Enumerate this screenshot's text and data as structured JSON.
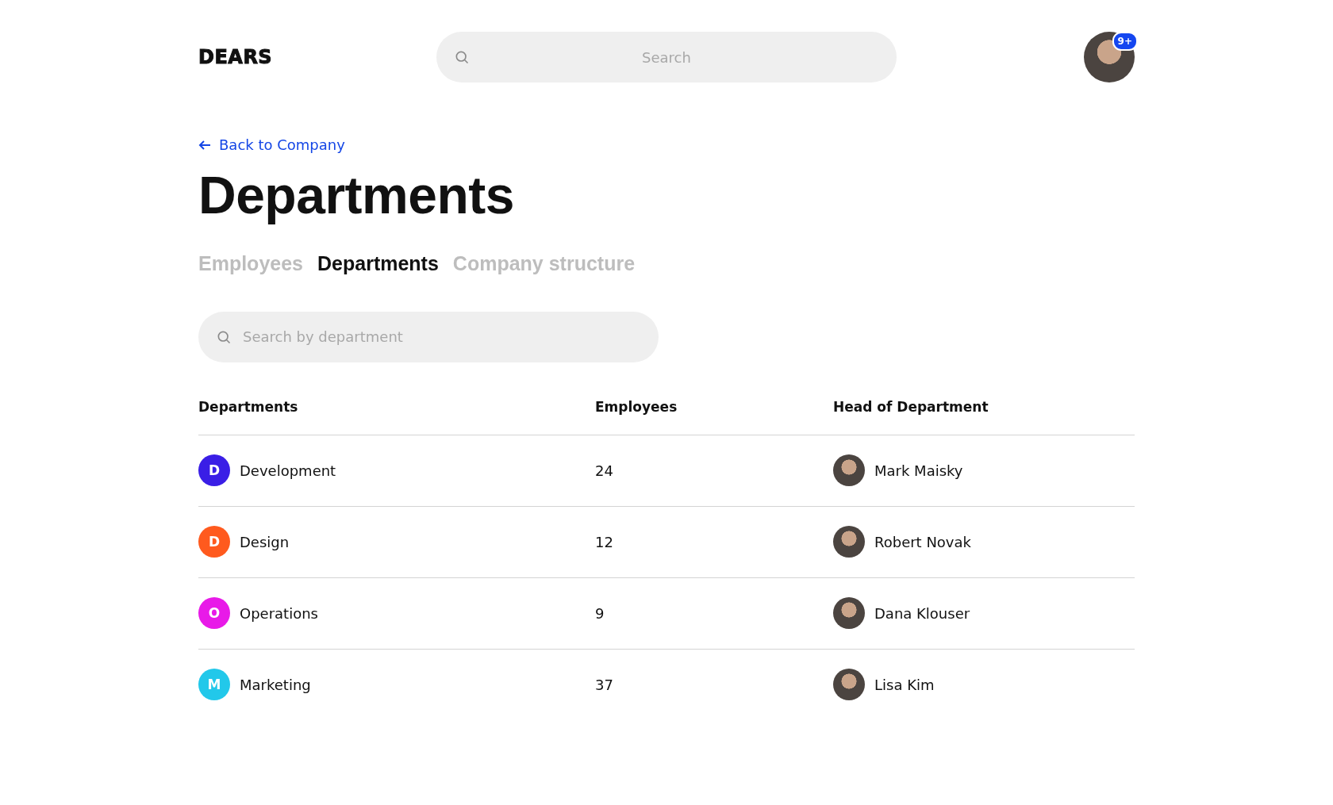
{
  "header": {
    "logo": "DEARS",
    "search": {
      "placeholder": "Search"
    },
    "notification_badge": "9+"
  },
  "back_link": "Back to Company",
  "title": "Departments",
  "tabs": [
    {
      "label": "Employees",
      "selected": false
    },
    {
      "label": "Departments",
      "selected": true
    },
    {
      "label": "Company structure",
      "selected": false
    }
  ],
  "department_search": {
    "placeholder": "Search by department"
  },
  "table": {
    "columns": [
      "Departments",
      "Employees",
      "Head of Department"
    ],
    "rows": [
      {
        "initial": "D",
        "color": "#3a1ee6",
        "department": "Development",
        "employees": "24",
        "head": "Mark Maisky"
      },
      {
        "initial": "D",
        "color": "#ff5a1e",
        "department": "Design",
        "employees": "12",
        "head": "Robert Novak"
      },
      {
        "initial": "O",
        "color": "#e81ae8",
        "department": "Operations",
        "employees": "9",
        "head": "Dana Klouser"
      },
      {
        "initial": "M",
        "color": "#22c8ea",
        "department": "Marketing",
        "employees": "37",
        "head": "Lisa Kim"
      }
    ]
  }
}
